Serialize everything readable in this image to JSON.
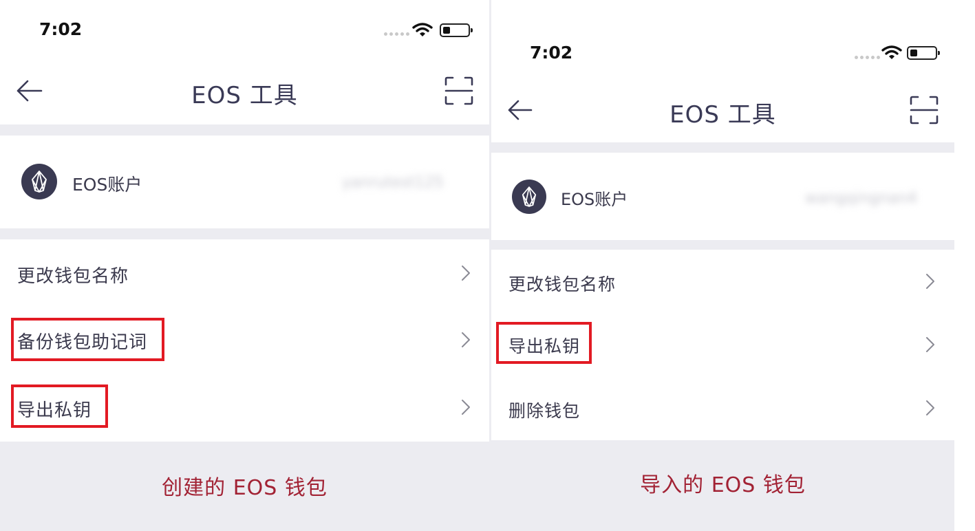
{
  "left": {
    "status": {
      "time": "7:02"
    },
    "nav": {
      "title": "EOS 工具"
    },
    "account": {
      "label": "EOS账户",
      "name": "yanrutest125"
    },
    "menu": [
      {
        "label": "更改钱包名称",
        "highlighted": false
      },
      {
        "label": "备份钱包助记词",
        "highlighted": true
      },
      {
        "label": "导出私钥",
        "highlighted": true
      }
    ],
    "caption": "创建的 EOS 钱包"
  },
  "right": {
    "status": {
      "time": "7:02"
    },
    "nav": {
      "title": "EOS 工具"
    },
    "account": {
      "label": "EOS账户",
      "name": "wangqingnan4"
    },
    "menu": [
      {
        "label": "更改钱包名称",
        "highlighted": false
      },
      {
        "label": "导出私钥",
        "highlighted": true
      },
      {
        "label": "删除钱包",
        "highlighted": false
      }
    ],
    "caption": "导入的 EOS 钱包"
  },
  "colors": {
    "highlight_border": "#e21a23",
    "caption_text": "#a22234",
    "section_gap": "#ececf1",
    "logo_bg": "#3a3a52"
  },
  "icons": [
    "back-arrow-icon",
    "scan-icon",
    "eos-logo-icon",
    "chevron-right-icon",
    "wifi-icon",
    "battery-icon",
    "signal-dots-icon"
  ]
}
